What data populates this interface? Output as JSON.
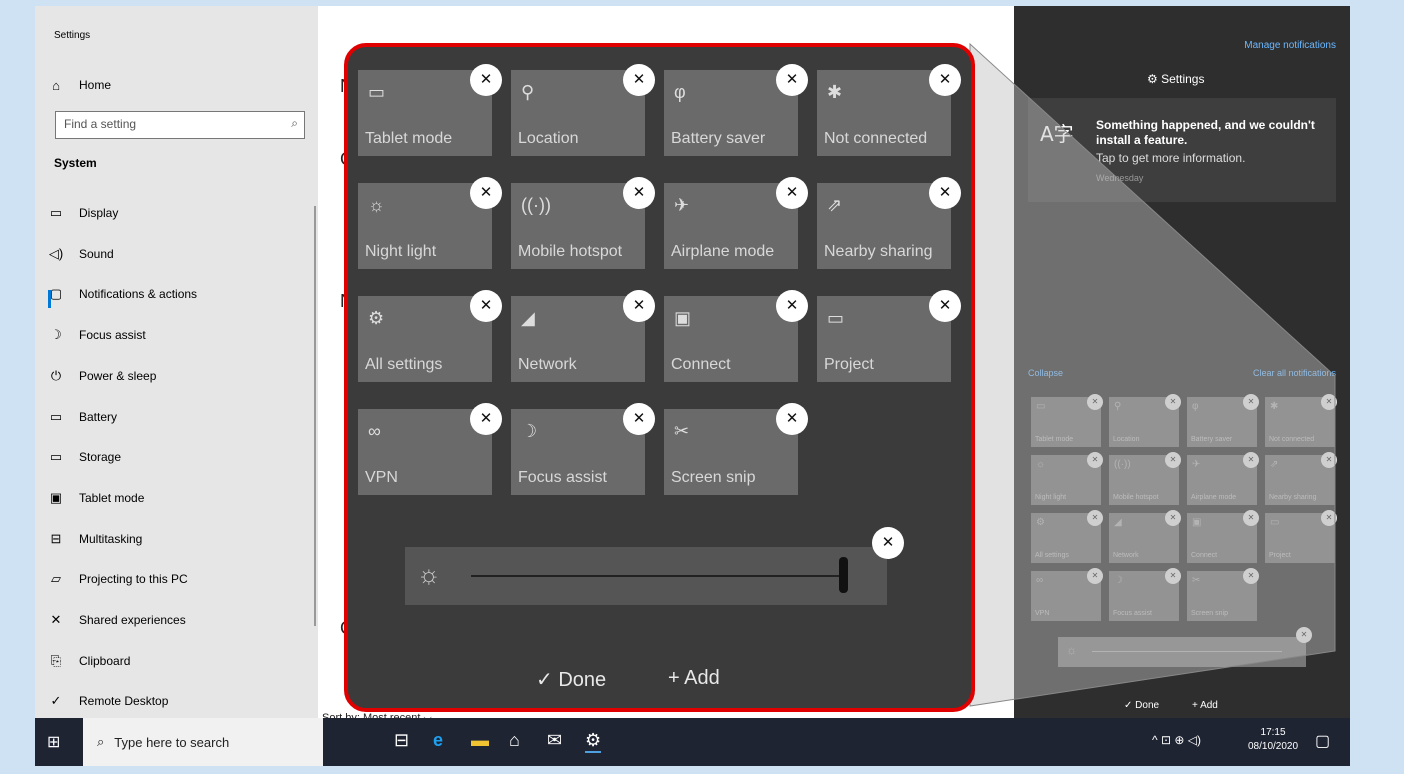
{
  "settings": {
    "app_title": "Settings",
    "home": "Home",
    "search_placeholder": "Find a setting",
    "section": "System",
    "nav": [
      {
        "label": "Display",
        "icon": "display-icon"
      },
      {
        "label": "Sound",
        "icon": "sound-icon"
      },
      {
        "label": "Notifications & actions",
        "icon": "notifications-icon"
      },
      {
        "label": "Focus assist",
        "icon": "moon-icon"
      },
      {
        "label": "Power & sleep",
        "icon": "power-icon"
      },
      {
        "label": "Battery",
        "icon": "battery-icon"
      },
      {
        "label": "Storage",
        "icon": "storage-icon"
      },
      {
        "label": "Tablet mode",
        "icon": "tablet-icon"
      },
      {
        "label": "Multitasking",
        "icon": "multitasking-icon"
      },
      {
        "label": "Projecting to this PC",
        "icon": "project-icon"
      },
      {
        "label": "Shared experiences",
        "icon": "shared-icon"
      },
      {
        "label": "Clipboard",
        "icon": "clipboard-icon"
      },
      {
        "label": "Remote Desktop",
        "icon": "remote-icon"
      }
    ],
    "sort_label": "Sort by: Most recent ⌵"
  },
  "popup": {
    "tiles": [
      {
        "label": "Tablet mode",
        "icon": "▭"
      },
      {
        "label": "Location",
        "icon": "⚲"
      },
      {
        "label": "Battery saver",
        "icon": "φ"
      },
      {
        "label": "Not connected",
        "icon": "✱"
      },
      {
        "label": "Night light",
        "icon": "☼"
      },
      {
        "label": "Mobile hotspot",
        "icon": "((·))"
      },
      {
        "label": "Airplane mode",
        "icon": "✈"
      },
      {
        "label": "Nearby sharing",
        "icon": "⇗"
      },
      {
        "label": "All settings",
        "icon": "⚙"
      },
      {
        "label": "Network",
        "icon": "◢"
      },
      {
        "label": "Connect",
        "icon": "▣"
      },
      {
        "label": "Project",
        "icon": "▭"
      },
      {
        "label": "VPN",
        "icon": "∞"
      },
      {
        "label": "Focus assist",
        "icon": "☽"
      },
      {
        "label": "Screen snip",
        "icon": "✂"
      }
    ],
    "done_label": "✓  Done",
    "add_label": "+  Add"
  },
  "action_center": {
    "manage": "Manage notifications",
    "settings_header": "⚙  Settings",
    "notification": {
      "title": "Something happened, and we couldn't install a feature.",
      "body": "Tap to get more information.",
      "date": "Wednesday",
      "icon": "A字"
    },
    "collapse": "Collapse",
    "clear_all": "Clear all notifications",
    "done": "✓  Done",
    "add": "+  Add"
  },
  "taskbar": {
    "search_placeholder": "Type here to search",
    "time": "17:15",
    "date": "08/10/2020",
    "tray": "^ ⊡ ⊕ ◁)"
  }
}
